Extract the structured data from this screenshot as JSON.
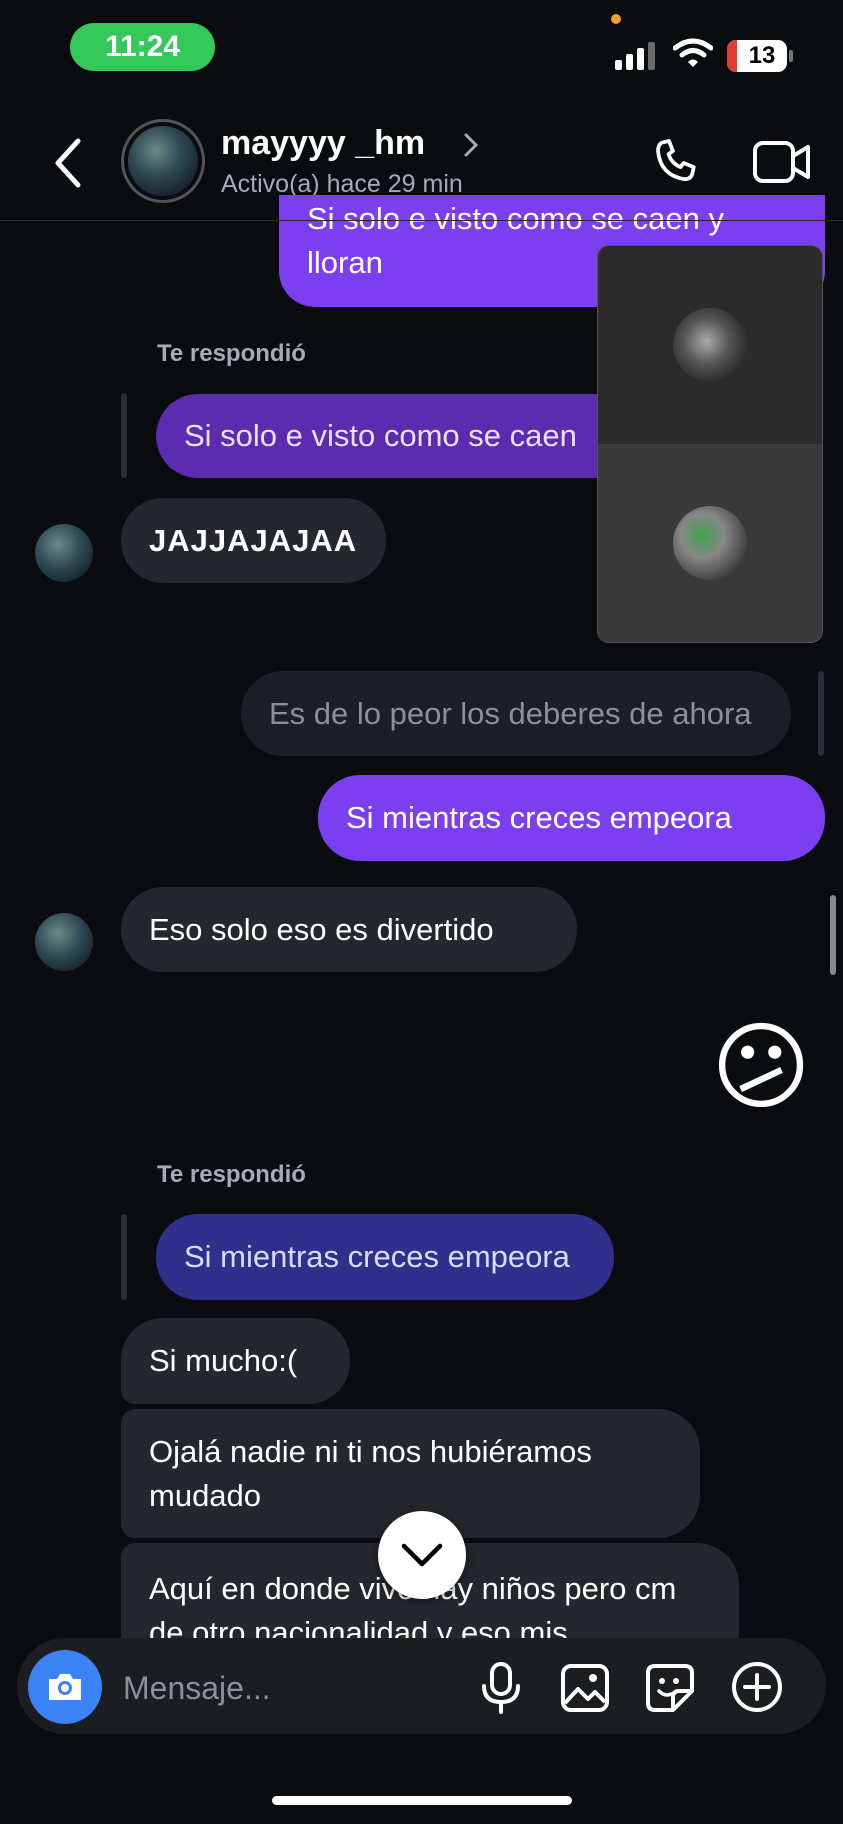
{
  "status_bar": {
    "time": "11:24",
    "battery": "13"
  },
  "header": {
    "username": "mayyyy _hm",
    "status": "Activo(a) hace 29 min",
    "chevron": "›"
  },
  "messages": {
    "top_sent": "Si solo e visto como se caen y lloran",
    "reply1_label": "Te respondió",
    "reply1_quote": "Si solo e visto como se caen",
    "recv1": "JAJJAJAJAA",
    "quoted_own": "Es de lo peor los deberes de ahora",
    "sent2": "Si mientras creces empeora",
    "recv2": "Eso solo eso es divertido",
    "emoji": "😕",
    "reply2_label": "Te respondió",
    "reply2_quote": "Si mientras creces empeora",
    "recv3": "Si mucho:(",
    "recv4": "Ojalá nadie ni ti nos hubiéramos mudado",
    "recv5": "Aquí en donde vivo hay niños pero cm de otro nacionalidad y eso mis"
  },
  "composer": {
    "placeholder": "Mensaje..."
  },
  "colors": {
    "background": "#0b0c10",
    "sent_bubble": "#7b3ff0",
    "received_bubble": "#26272c",
    "reply_quote_purple": "#5b2bb0",
    "reply_quote_blue": "#2f2f8c",
    "camera_button": "#3b82f6",
    "time_pill": "#34c759"
  },
  "icons": [
    "back-icon",
    "chevron-right-icon",
    "phone-icon",
    "video-icon",
    "camera-icon",
    "microphone-icon",
    "gallery-icon",
    "sticker-icon",
    "plus-icon",
    "scroll-down-icon",
    "signal-icon",
    "wifi-icon"
  ]
}
